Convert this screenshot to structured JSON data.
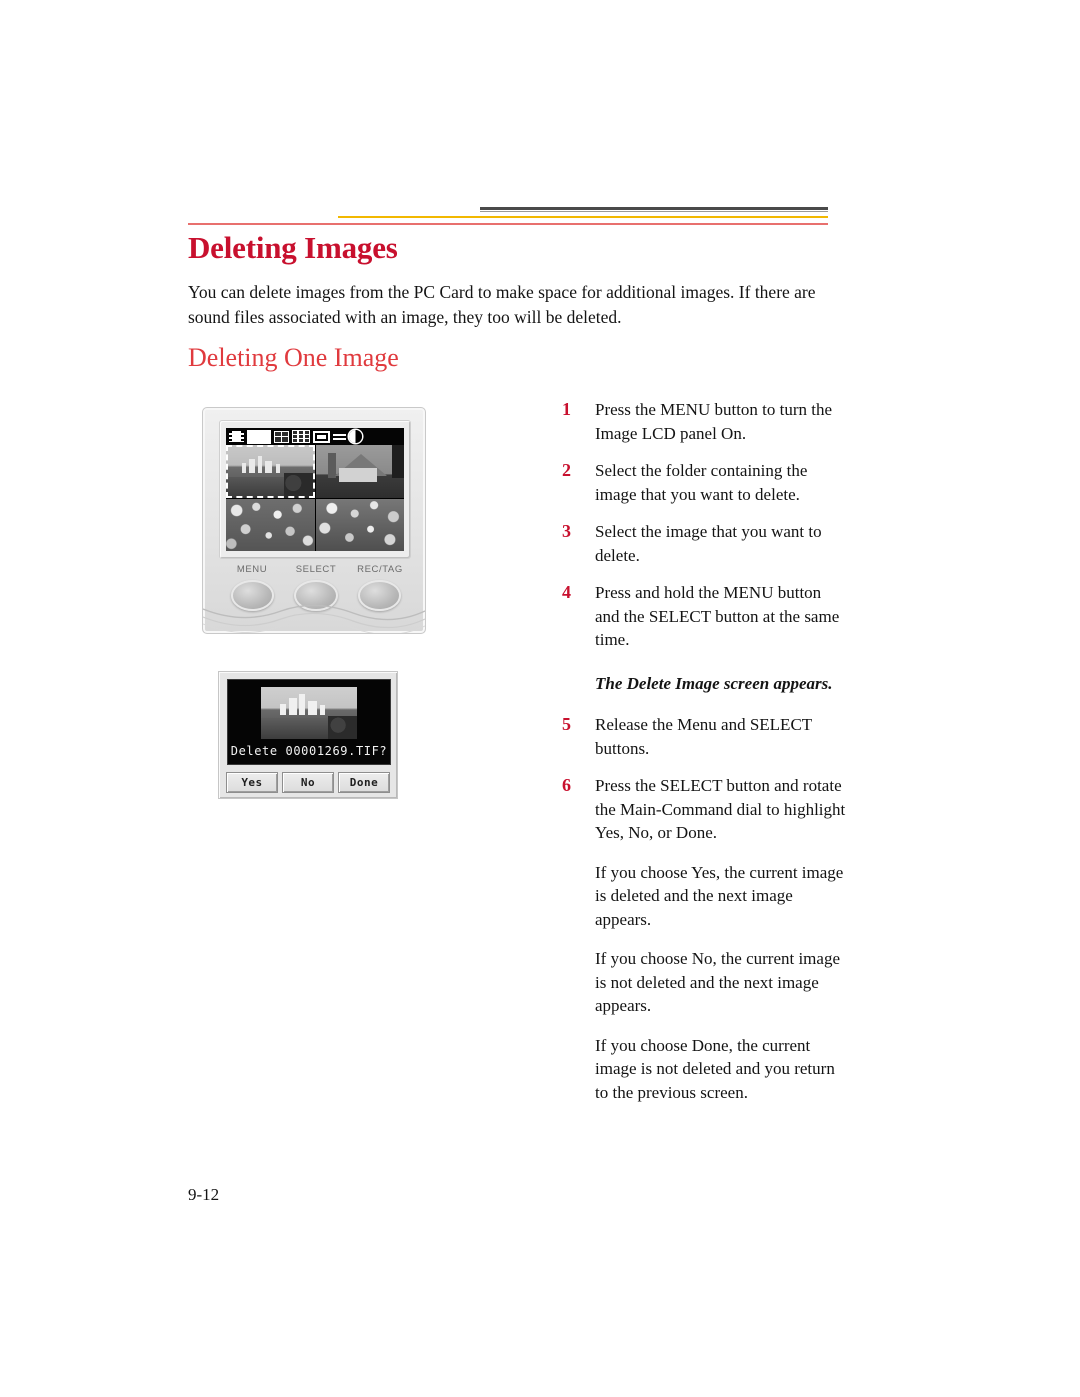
{
  "page": {
    "title": "Deleting Images",
    "subtitle": "Deleting One Image",
    "intro": "You can delete images from the PC Card to make space for additional images. If there are sound files associated with an image, they too will be deleted.",
    "folio": "9-12"
  },
  "steps": [
    {
      "num": "1",
      "text": "Press the MENU button to turn the Image LCD panel On."
    },
    {
      "num": "2",
      "text": "Select the folder containing the image that you want to delete."
    },
    {
      "num": "3",
      "text": "Select the image that you want to delete."
    },
    {
      "num": "4",
      "text": "Press and hold the MENU button and the SELECT button at the same time."
    }
  ],
  "note": "The Delete Image screen appears.",
  "steps2": [
    {
      "num": "5",
      "text": "Release the Menu and SELECT buttons."
    },
    {
      "num": "6",
      "text": "Press the SELECT button and rotate the Main-Command dial to highlight Yes, No, or Done."
    }
  ],
  "outcomes": [
    "If you choose Yes, the current image is deleted and the next image appears.",
    "If you choose No, the current image is not deleted and the next image appears.",
    "If you choose Done, the current image is not deleted and you return to the previous screen."
  ],
  "camera": {
    "buttons": [
      "MENU",
      "SELECT",
      "REC/TAG"
    ],
    "toolbar_icons": [
      "filmstrip-icon",
      "single-image-icon",
      "grid-2x2-icon",
      "grid-3x3-icon",
      "folder-icon",
      "settings-lines-icon",
      "contrast-icon"
    ],
    "thumbnails": [
      {
        "name": "city-skyline-thumbnail",
        "selected": true
      },
      {
        "name": "house-thumbnail",
        "selected": false
      },
      {
        "name": "crowd-thumbnail-1",
        "selected": false
      },
      {
        "name": "crowd-thumbnail-2",
        "selected": false
      }
    ]
  },
  "delete_screen": {
    "prompt": "Delete 00001269.TIF?",
    "buttons": [
      "Yes",
      "No",
      "Done"
    ]
  },
  "colors": {
    "heading_red": "#c8102e",
    "subheading_red": "#e03a3e",
    "rule_gold": "#f2b800",
    "rule_red": "#e8706e",
    "rule_dark": "#4a4a4a"
  }
}
